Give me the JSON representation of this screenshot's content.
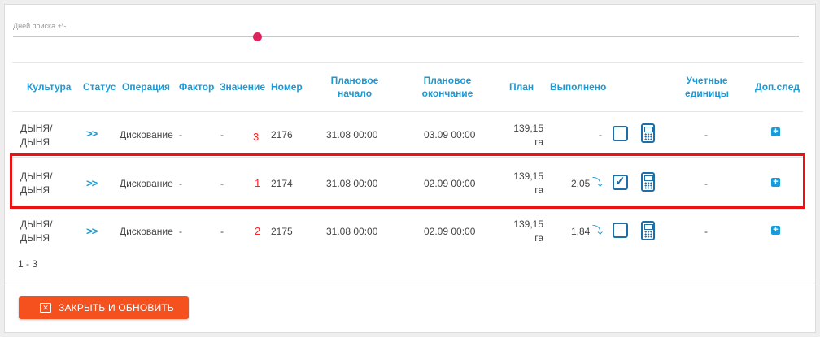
{
  "slider": {
    "label": "Дней поиска +\\-",
    "value_fraction": 0.31
  },
  "columns": {
    "culture": "Культура",
    "status": "Статус",
    "operation": "Операция",
    "factor": "Фактор",
    "value": "Значение",
    "number": "Номер",
    "plan_start": "Плановое начало",
    "plan_end": "Плановое окончание",
    "plan": "План",
    "done": "Выполнено",
    "units": "Учетные единицы",
    "extra": "Доп.след"
  },
  "rows": [
    {
      "culture": "ДЫНЯ/ ДЫНЯ",
      "status_icon": "double-chevron-right-icon",
      "operation": "Дискование",
      "factor": "-",
      "value": "-",
      "marker": "3",
      "number": "2176",
      "plan_start": "31.08 00:00",
      "plan_end": "03.09 00:00",
      "plan": "139,15 га",
      "done": "-",
      "checked": false,
      "units": "-"
    },
    {
      "culture": "ДЫНЯ/ ДЫНЯ",
      "status_icon": "double-chevron-right-icon",
      "operation": "Дискование",
      "factor": "-",
      "value": "-",
      "marker": "1",
      "number": "2174",
      "plan_start": "31.08 00:00",
      "plan_end": "02.09 00:00",
      "plan": "139,15 га",
      "done": "2,05",
      "checked": true,
      "units": "-"
    },
    {
      "culture": "ДЫНЯ/ ДЫНЯ",
      "status_icon": "double-chevron-right-icon",
      "operation": "Дискование",
      "factor": "-",
      "value": "-",
      "marker": "2",
      "number": "2175",
      "plan_start": "31.08 00:00",
      "plan_end": "02.09 00:00",
      "plan": "139,15 га",
      "done": "1,84",
      "checked": false,
      "units": "-"
    }
  ],
  "pager": "1 - 3",
  "button": {
    "label": "ЗАКРЫТЬ И ОБНОВИТЬ",
    "icon": "close-box-icon"
  },
  "colors": {
    "accent": "#1a9ad6",
    "button": "#f4511e",
    "highlight": "#ee1111",
    "slider_thumb": "#e0245e"
  }
}
